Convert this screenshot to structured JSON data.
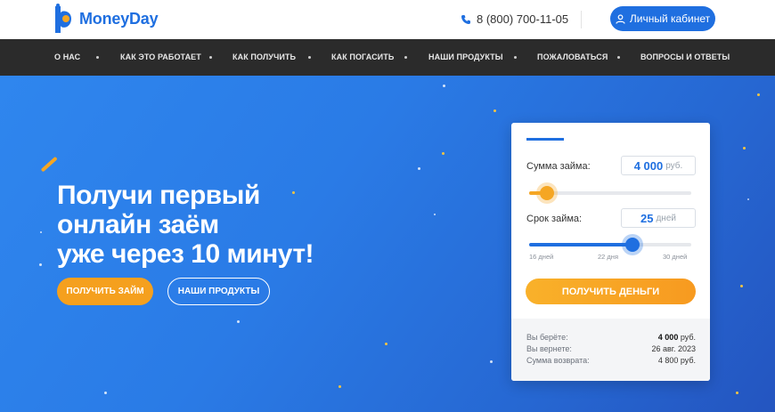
{
  "header": {
    "logo_text": "MoneyDay",
    "phone": "8 (800) 700-11-05",
    "cabinet_label": "Личный кабинет"
  },
  "nav": {
    "items": [
      {
        "label": "О НАС"
      },
      {
        "label": "КАК ЭТО РАБОТАЕТ"
      },
      {
        "label": "КАК ПОЛУЧИТЬ"
      },
      {
        "label": "КАК ПОГАСИТЬ"
      },
      {
        "label": "НАШИ ПРОДУКТЫ"
      },
      {
        "label": "ПОЖАЛОВАТЬСЯ"
      },
      {
        "label": "ВОПРОСЫ И ОТВЕТЫ"
      }
    ]
  },
  "hero": {
    "headline_lines": [
      "Получи первый",
      "онлайн заём",
      "уже через 10 минут!"
    ],
    "primary_button": "ПОЛУЧИТЬ ЗАЙМ",
    "secondary_button": "НАШИ ПРОДУКТЫ"
  },
  "calculator": {
    "amount_label": "Сумма займа:",
    "amount_value": "4 000",
    "amount_unit": "руб.",
    "amount_slider_fraction": 0.11,
    "term_label": "Срок займа:",
    "term_value": "25",
    "term_unit": "дней",
    "term_slider_fraction": 0.64,
    "term_ticks": [
      "16 дней",
      "22 дня",
      "30 дней"
    ],
    "submit_label": "ПОЛУЧИТЬ ДЕНЬГИ",
    "summary": [
      {
        "label": "Вы берёте:",
        "value": "4 000",
        "unit": " руб."
      },
      {
        "label": "Вы вернете:",
        "value": "26 авг. 2023",
        "unit": ""
      },
      {
        "label": "Сумма возврата:",
        "value": "4 800 руб.",
        "unit": ""
      }
    ]
  },
  "colors": {
    "brand_blue": "#1f6fe0",
    "accent_orange": "#f5a01e",
    "nav_bg": "#2b2b2b"
  }
}
